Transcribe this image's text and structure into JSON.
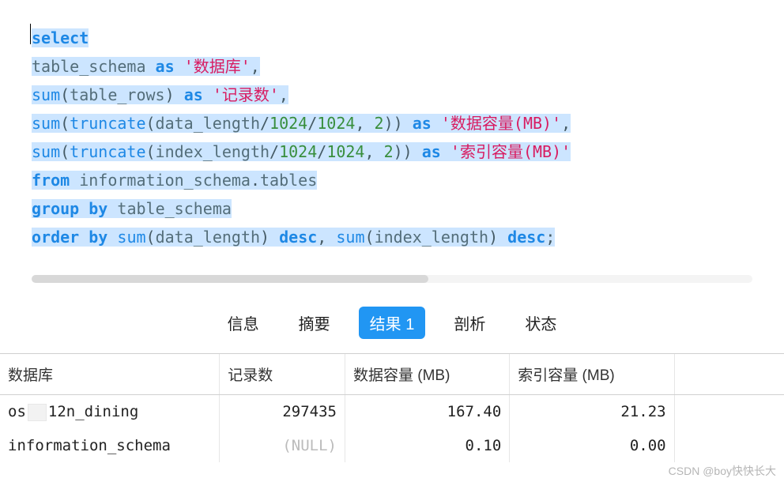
{
  "sql": {
    "l1": {
      "select": "select"
    },
    "l2": {
      "col": "table_schema",
      "as": "as",
      "alias": "'数据库'",
      "comma": ","
    },
    "l3": {
      "fn": "sum",
      "open": "(",
      "col": "table_rows",
      "close": ")",
      "as": "as",
      "alias": "'记录数'",
      "comma": ","
    },
    "l4": {
      "fn1": "sum",
      "o1": "(",
      "fn2": "truncate",
      "o2": "(",
      "col": "data_length",
      "slash": "/",
      "n1": "1024",
      "n2": "1024",
      "comma1": ", ",
      "prec": "2",
      "c2": "))",
      "as": "as",
      "alias": "'数据容量(MB)'",
      "comma": ","
    },
    "l5": {
      "fn1": "sum",
      "o1": "(",
      "fn2": "truncate",
      "o2": "(",
      "col": "index_length",
      "slash": "/",
      "n1": "1024",
      "n2": "1024",
      "comma1": ", ",
      "prec": "2",
      "c2": "))",
      "as": "as",
      "alias": "'索引容量(MB)'"
    },
    "l6": {
      "from": "from",
      "schema": "information_schema",
      "dot": ".",
      "table": "tables"
    },
    "l7": {
      "group": "group",
      "by": "by",
      "col": "table_schema"
    },
    "l8": {
      "order": "order",
      "by": "by",
      "fn1": "sum",
      "o1": "(",
      "c1": "data_length",
      "cl1": ")",
      "desc1": "desc",
      "comma": ", ",
      "fn2": "sum",
      "o2": "(",
      "c2": "index_length",
      "cl2": ")",
      "desc2": "desc",
      "semi": ";"
    }
  },
  "tabs": {
    "info": "信息",
    "summary": "摘要",
    "result": "结果 1",
    "profile": "剖析",
    "status": "状态"
  },
  "table": {
    "headers": {
      "db": "数据库",
      "rows": "记录数",
      "data": "数据容量 (MB)",
      "index": "索引容量 (MB)"
    },
    "rows": {
      "0": {
        "db_pre": "os",
        "db_suf": "12n_dining",
        "rows": "297435",
        "data": "167.40",
        "index": "21.23"
      },
      "1": {
        "db": "information_schema",
        "rows": "(NULL)",
        "data": "0.10",
        "index": "0.00"
      }
    }
  },
  "watermark": "CSDN @boy快快长大"
}
